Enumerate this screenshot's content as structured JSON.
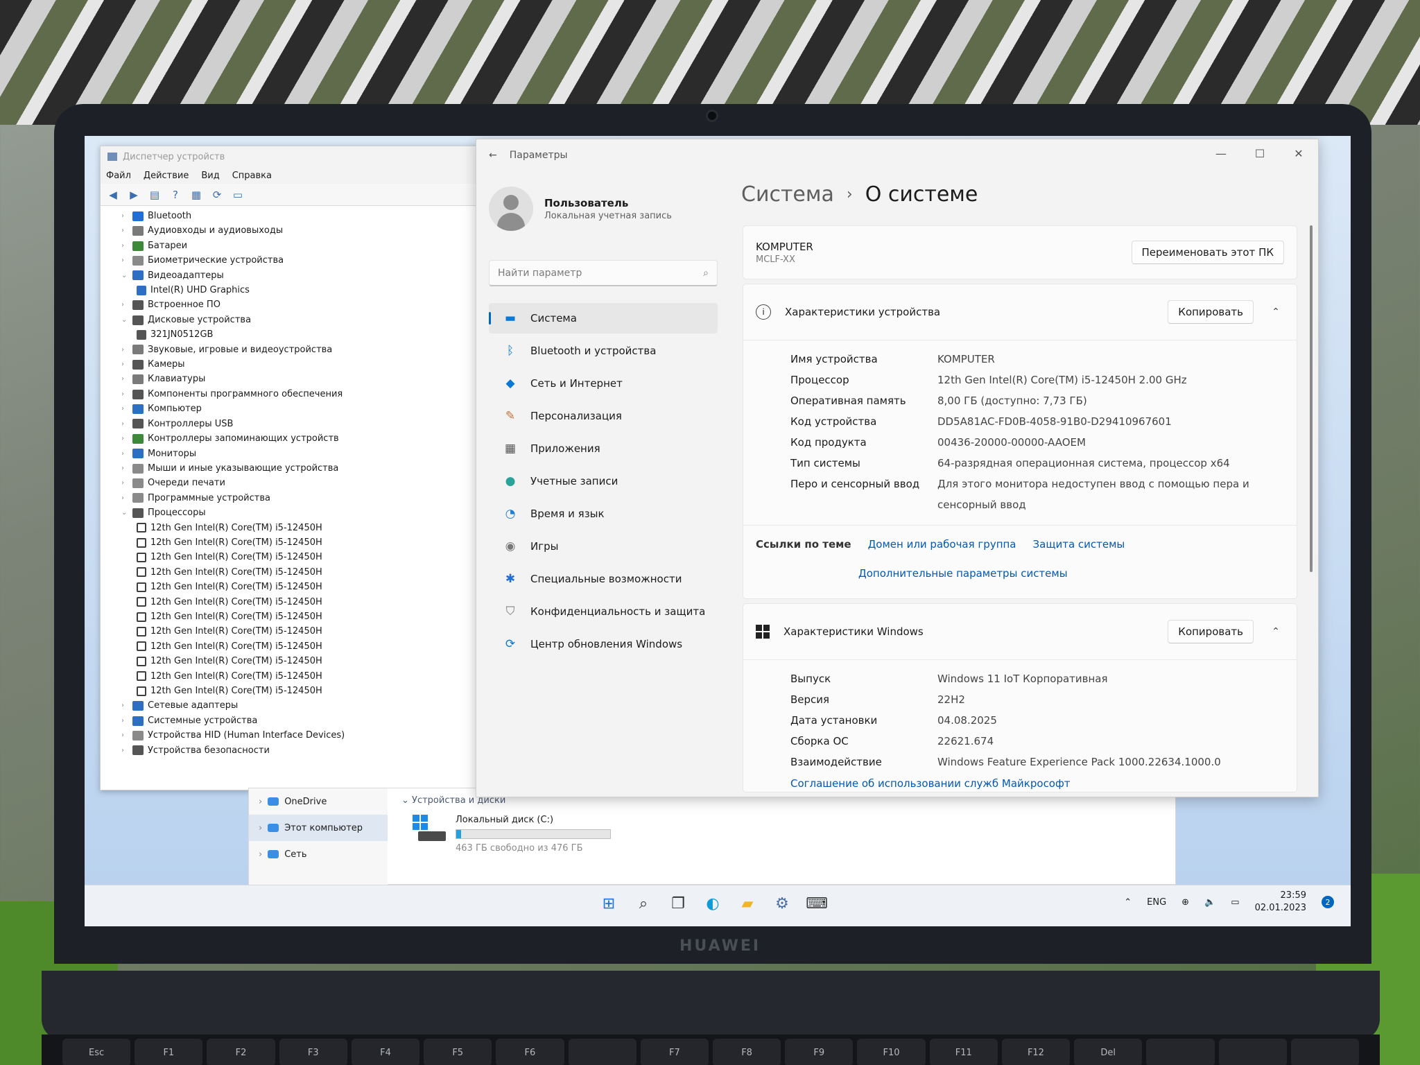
{
  "device_manager": {
    "title": "Диспетчер устройств",
    "menu": [
      "Файл",
      "Действие",
      "Вид",
      "Справка"
    ],
    "tree": [
      {
        "label": "Bluetooth",
        "level": 1,
        "icon": "bluetooth-icon",
        "color": "#1f6fd6"
      },
      {
        "label": "Аудиовходы и аудиовыходы",
        "level": 1,
        "icon": "speaker-icon",
        "color": "#7a7a7a"
      },
      {
        "label": "Батареи",
        "level": 1,
        "icon": "battery-icon",
        "color": "#3a8a3a"
      },
      {
        "label": "Биометрические устройства",
        "level": 1,
        "icon": "biometric-icon",
        "color": "#8a8a8a"
      },
      {
        "label": "Видеоадаптеры",
        "level": 1,
        "icon": "display-adapter-icon",
        "color": "#2d6fc2",
        "expanded": true
      },
      {
        "label": "Intel(R) UHD Graphics",
        "level": 2,
        "icon": "display-adapter-icon",
        "color": "#2d6fc2"
      },
      {
        "label": "Встроенное ПО",
        "level": 1,
        "icon": "firmware-icon",
        "color": "#555555"
      },
      {
        "label": "Дисковые устройства",
        "level": 1,
        "icon": "disk-icon",
        "color": "#555555",
        "expanded": true
      },
      {
        "label": "321JN0512GB",
        "level": 2,
        "icon": "disk-icon",
        "color": "#555555"
      },
      {
        "label": "Звуковые, игровые и видеоустройства",
        "level": 1,
        "icon": "sound-icon",
        "color": "#7a7a7a"
      },
      {
        "label": "Камеры",
        "level": 1,
        "icon": "camera-icon",
        "color": "#555555"
      },
      {
        "label": "Клавиатуры",
        "level": 1,
        "icon": "keyboard-icon",
        "color": "#7a7a7a"
      },
      {
        "label": "Компоненты программного обеспечения",
        "level": 1,
        "icon": "software-component-icon",
        "color": "#555555"
      },
      {
        "label": "Компьютер",
        "level": 1,
        "icon": "computer-icon",
        "color": "#2d6fc2"
      },
      {
        "label": "Контроллеры USB",
        "level": 1,
        "icon": "usb-icon",
        "color": "#555555"
      },
      {
        "label": "Контроллеры запоминающих устройств",
        "level": 1,
        "icon": "storage-controller-icon",
        "color": "#3a8a3a"
      },
      {
        "label": "Мониторы",
        "level": 1,
        "icon": "monitor-icon",
        "color": "#2d6fc2"
      },
      {
        "label": "Мыши и иные указывающие устройства",
        "level": 1,
        "icon": "mouse-icon",
        "color": "#8a8a8a"
      },
      {
        "label": "Очереди печати",
        "level": 1,
        "icon": "printer-icon",
        "color": "#8a8a8a"
      },
      {
        "label": "Программные устройства",
        "level": 1,
        "icon": "software-device-icon",
        "color": "#8a8a8a"
      },
      {
        "label": "Процессоры",
        "level": 1,
        "icon": "processor-icon",
        "color": "#555555",
        "expanded": true
      },
      {
        "label": "12th Gen Intel(R) Core(TM) i5-12450H",
        "level": 2,
        "icon": "processor-icon"
      },
      {
        "label": "12th Gen Intel(R) Core(TM) i5-12450H",
        "level": 2,
        "icon": "processor-icon"
      },
      {
        "label": "12th Gen Intel(R) Core(TM) i5-12450H",
        "level": 2,
        "icon": "processor-icon"
      },
      {
        "label": "12th Gen Intel(R) Core(TM) i5-12450H",
        "level": 2,
        "icon": "processor-icon"
      },
      {
        "label": "12th Gen Intel(R) Core(TM) i5-12450H",
        "level": 2,
        "icon": "processor-icon"
      },
      {
        "label": "12th Gen Intel(R) Core(TM) i5-12450H",
        "level": 2,
        "icon": "processor-icon"
      },
      {
        "label": "12th Gen Intel(R) Core(TM) i5-12450H",
        "level": 2,
        "icon": "processor-icon"
      },
      {
        "label": "12th Gen Intel(R) Core(TM) i5-12450H",
        "level": 2,
        "icon": "processor-icon"
      },
      {
        "label": "12th Gen Intel(R) Core(TM) i5-12450H",
        "level": 2,
        "icon": "processor-icon"
      },
      {
        "label": "12th Gen Intel(R) Core(TM) i5-12450H",
        "level": 2,
        "icon": "processor-icon"
      },
      {
        "label": "12th Gen Intel(R) Core(TM) i5-12450H",
        "level": 2,
        "icon": "processor-icon"
      },
      {
        "label": "12th Gen Intel(R) Core(TM) i5-12450H",
        "level": 2,
        "icon": "processor-icon"
      },
      {
        "label": "Сетевые адаптеры",
        "level": 1,
        "icon": "network-adapter-icon",
        "color": "#2d6fc2"
      },
      {
        "label": "Системные устройства",
        "level": 1,
        "icon": "system-device-icon",
        "color": "#2d6fc2"
      },
      {
        "label": "Устройства HID (Human Interface Devices)",
        "level": 1,
        "icon": "hid-icon",
        "color": "#8a8a8a"
      },
      {
        "label": "Устройства безопасности",
        "level": 1,
        "icon": "security-device-icon",
        "color": "#555555"
      }
    ]
  },
  "explorer": {
    "nav": [
      {
        "label": "OneDrive",
        "icon": "onedrive-icon"
      },
      {
        "label": "Этот компьютер",
        "icon": "this-pc-icon",
        "selected": true
      },
      {
        "label": "Сеть",
        "icon": "network-icon"
      }
    ],
    "group_label": "Устройства и диски",
    "drive": {
      "name": "Локальный диск (C:)",
      "free_text": "463 ГБ свободно из 476 ГБ",
      "used_fraction": 0.03
    }
  },
  "settings": {
    "window_title": "Параметры",
    "user": {
      "name": "Пользователь",
      "account_type": "Локальная учетная запись"
    },
    "search_placeholder": "Найти параметр",
    "menu": [
      {
        "label": "Система",
        "icon": "system-icon",
        "selected": true
      },
      {
        "label": "Bluetooth и устройства",
        "icon": "bluetooth-icon"
      },
      {
        "label": "Сеть и Интернет",
        "icon": "wifi-icon"
      },
      {
        "label": "Персонализация",
        "icon": "brush-icon"
      },
      {
        "label": "Приложения",
        "icon": "apps-icon"
      },
      {
        "label": "Учетные записи",
        "icon": "account-icon"
      },
      {
        "label": "Время и язык",
        "icon": "globe-clock-icon"
      },
      {
        "label": "Игры",
        "icon": "gamepad-icon"
      },
      {
        "label": "Специальные возможности",
        "icon": "accessibility-icon"
      },
      {
        "label": "Конфиденциальность и защита",
        "icon": "shield-icon"
      },
      {
        "label": "Центр обновления Windows",
        "icon": "update-icon"
      }
    ],
    "breadcrumb": {
      "parent": "Система",
      "separator": "›",
      "current": "О системе"
    },
    "pc": {
      "name": "KOMPUTER",
      "model": "MCLF-XX",
      "rename_button": "Переименовать этот ПК"
    },
    "device_specs": {
      "title": "Характеристики устройства",
      "copy_button": "Копировать",
      "rows": [
        {
          "key": "Имя устройства",
          "value": "KOMPUTER"
        },
        {
          "key": "Процессор",
          "value": "12th Gen Intel(R) Core(TM) i5-12450H   2.00 GHz"
        },
        {
          "key": "Оперативная память",
          "value": "8,00 ГБ (доступно: 7,73 ГБ)"
        },
        {
          "key": "Код устройства",
          "value": "DD5A81AC-FD0B-4058-91B0-D29410967601"
        },
        {
          "key": "Код продукта",
          "value": "00436-20000-00000-AAOEM"
        },
        {
          "key": "Тип системы",
          "value": "64-разрядная операционная система, процессор x64"
        },
        {
          "key": "Перо и сенсорный ввод",
          "value": "Для этого монитора недоступен ввод с помощью пера и сенсорный ввод"
        }
      ]
    },
    "related": {
      "label": "Ссылки по теме",
      "links": [
        "Домен или рабочая группа",
        "Защита системы"
      ],
      "advanced_link": "Дополнительные параметры системы"
    },
    "windows_specs": {
      "title": "Характеристики Windows",
      "copy_button": "Копировать",
      "rows": [
        {
          "key": "Выпуск",
          "value": "Windows 11 IoT Корпоративная"
        },
        {
          "key": "Версия",
          "value": "22H2"
        },
        {
          "key": "Дата установки",
          "value": "04.08.2025"
        },
        {
          "key": "Сборка ОС",
          "value": "22621.674"
        },
        {
          "key": "Взаимодействие",
          "value": "Windows Feature Experience Pack 1000.22634.1000.0"
        }
      ],
      "agreement_link": "Соглашение об использовании служб Майкрософт"
    }
  },
  "taskbar": {
    "apps": [
      {
        "icon": "windows-start-icon"
      },
      {
        "icon": "search-icon"
      },
      {
        "icon": "task-view-icon"
      },
      {
        "icon": "edge-icon"
      },
      {
        "icon": "file-explorer-icon"
      },
      {
        "icon": "settings-gear-icon"
      },
      {
        "icon": "device-manager-icon"
      }
    ],
    "language": "ENG",
    "time": "23:59",
    "date": "02.01.2023",
    "notification_count": "2"
  },
  "laptop": {
    "brand": "HUAWEI",
    "keys": [
      "Esc",
      "F1",
      "F2",
      "F3",
      "F4",
      "F5",
      "F6",
      "",
      "F7",
      "F8",
      "F9",
      "F10",
      "F11",
      "F12",
      "Del",
      "",
      "",
      ""
    ]
  }
}
